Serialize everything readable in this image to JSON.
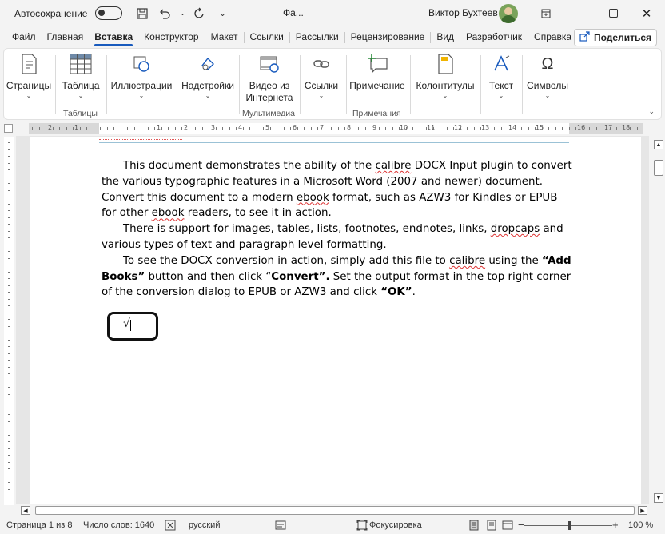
{
  "titlebar": {
    "autosave_label": "Автосохранение",
    "doc_title": "Фа...",
    "user_name": "Виктор Бухтеев"
  },
  "tabs": [
    "Файл",
    "Главная",
    "Вставка",
    "Конструктор",
    "Макет",
    "Ссылки",
    "Рассылки",
    "Рецензирование",
    "Вид",
    "Разработчик",
    "Справка"
  ],
  "active_tab": "Вставка",
  "share_label": "Поделиться",
  "ribbon": {
    "pages_label": "Страницы",
    "table_label": "Таблица",
    "tables_group": "Таблицы",
    "illustrations_label": "Иллюстрации",
    "addins_label": "Надстройки",
    "video_label_1": "Видео из",
    "video_label_2": "Интернета",
    "media_group": "Мультимедиа",
    "links_label": "Ссылки",
    "comment_label": "Примечание",
    "comments_group": "Примечания",
    "headers_label": "Колонтитулы",
    "text_label": "Текст",
    "symbols_label": "Символы"
  },
  "document": {
    "p1_a": "This document demonstrates the ability of the ",
    "p1_calibre": "calibre",
    "p1_b": " DOCX Input plugin to convert the various typographic features in a Microsoft Word (2007 and newer) document. Convert this document to a modern ",
    "p1_ebook": "ebook",
    "p1_c": " format, such as AZW3 for Kindles or EPUB for other ",
    "p1_ebook2": "ebook",
    "p1_d": " readers, to see it in action.",
    "p2_a": "There is support for images, tables, lists, footnotes, endnotes, links, ",
    "p2_dropcaps": "dropcaps",
    "p2_b": " and various types of text and paragraph level formatting.",
    "p3_a": "To see the DOCX conversion in action, simply add this file to ",
    "p3_calibre": "calibre",
    "p3_b": " using the ",
    "p3_addbooks": "“Add Books”",
    "p3_c": " button and then click “",
    "p3_convert": "Convert”.",
    "p3_d": "  Set the output format in the top right corner of the conversion dialog to EPUB or AZW3 and click ",
    "p3_ok": "“OK”",
    "p3_e": ".",
    "math_symbol": "√"
  },
  "status": {
    "page": "Страница 1 из 8",
    "words": "Число слов: 1640",
    "language": "русский",
    "focus": "Фокусировка",
    "zoom": "100 %",
    "minus": "−",
    "plus": "+"
  },
  "ruler_numbers": [
    "2",
    "1",
    "1",
    "2",
    "3",
    "4",
    "5",
    "6",
    "7",
    "8",
    "9",
    "10",
    "11",
    "12",
    "13",
    "14",
    "15",
    "16",
    "17",
    "18"
  ]
}
